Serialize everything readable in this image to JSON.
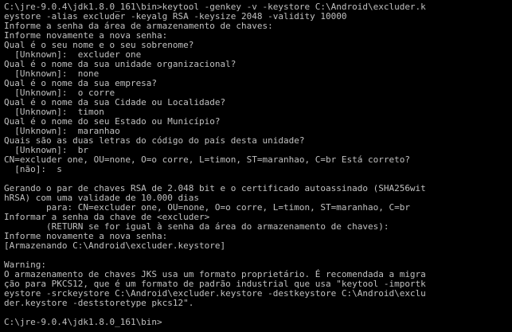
{
  "console": {
    "foreground": "#c0c0c0",
    "background": "#000000",
    "lines": [
      "C:\\jre-9.0.4\\jdk1.8.0_161\\bin>keytool -genkey -v -keystore C:\\Android\\excluder.k",
      "eystore -alias excluder -keyalg RSA -keysize 2048 -validity 10000",
      "Informe a senha da área de armazenamento de chaves:",
      "Informe novamente a nova senha:",
      "Qual é o seu nome e o seu sobrenome?",
      "  [Unknown]:  excluder one",
      "Qual é o nome da sua unidade organizacional?",
      "  [Unknown]:  none",
      "Qual é o nome da sua empresa?",
      "  [Unknown]:  o corre",
      "Qual é o nome da sua Cidade ou Localidade?",
      "  [Unknown]:  timon",
      "Qual é o nome do seu Estado ou Município?",
      "  [Unknown]:  maranhao",
      "Quais são as duas letras do código do país desta unidade?",
      "  [Unknown]:  br",
      "CN=excluder one, OU=none, O=o corre, L=timon, ST=maranhao, C=br Está correto?",
      "  [não]:  s",
      "",
      "Gerando o par de chaves RSA de 2.048 bit e o certificado autoassinado (SHA256wit",
      "hRSA) com uma validade de 10.000 dias",
      "        para: CN=excluder one, OU=none, O=o corre, L=timon, ST=maranhao, C=br",
      "Informar a senha da chave de <excluder>",
      "        (RETURN se for igual à senha da área do armazenamento de chaves):",
      "Informe novamente a nova senha:",
      "[Armazenando C:\\Android\\excluder.keystore]",
      "",
      "Warning:",
      "O armazenamento de chaves JKS usa um formato proprietário. É recomendada a migra",
      "ção para PKCS12, que é um formato de padrão industrial que usa \"keytool -importk",
      "eystore -srckeystore C:\\Android\\excluder.keystore -destkeystore C:\\Android\\exclu",
      "der.keystore -deststoretype pkcs12\".",
      "",
      "C:\\jre-9.0.4\\jdk1.8.0_161\\bin>"
    ]
  }
}
